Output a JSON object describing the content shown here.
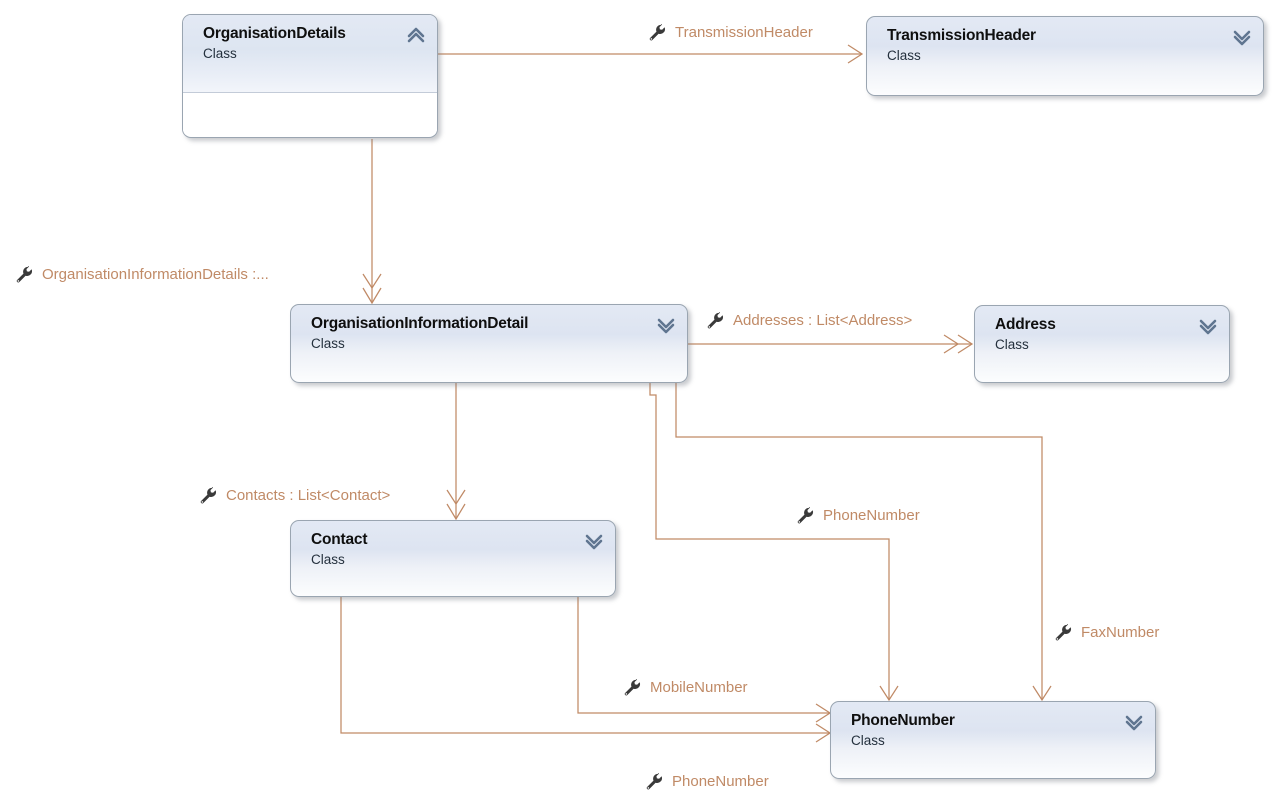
{
  "diagram": {
    "title": "Class Diagram",
    "link_color": "#c08a66",
    "label_color": "#c08a66",
    "class_fill_top": "#e3e9f4",
    "class_fill_bottom": "#fcfdfe",
    "class_border": "#9aa5b1"
  },
  "classes": [
    {
      "id": "organisation-details",
      "name": "OrganisationDetails",
      "stereotype": "Class",
      "expanded": true,
      "chevron": "chevron-up-icon"
    },
    {
      "id": "transmission-header",
      "name": "TransmissionHeader",
      "stereotype": "Class",
      "expanded": false,
      "chevron": "chevron-down-icon"
    },
    {
      "id": "organisation-information-detail",
      "name": "OrganisationInformationDetail",
      "stereotype": "Class",
      "expanded": false,
      "chevron": "chevron-down-icon"
    },
    {
      "id": "address",
      "name": "Address",
      "stereotype": "Class",
      "expanded": false,
      "chevron": "chevron-down-icon"
    },
    {
      "id": "contact",
      "name": "Contact",
      "stereotype": "Class",
      "expanded": false,
      "chevron": "chevron-down-icon"
    },
    {
      "id": "phone-number",
      "name": "PhoneNumber",
      "stereotype": "Class",
      "expanded": false,
      "chevron": "chevron-down-icon"
    }
  ],
  "associations": [
    {
      "id": "assoc-transmission-header",
      "label": "TransmissionHeader",
      "icon": "property-wrench-icon",
      "from": "organisation-details",
      "to": "transmission-header",
      "arrow": "single"
    },
    {
      "id": "assoc-organisation-information-details",
      "label": "OrganisationInformationDetails  :...",
      "icon": "property-wrench-icon",
      "from": "organisation-details",
      "to": "organisation-information-detail",
      "arrow": "double"
    },
    {
      "id": "assoc-addresses",
      "label": "Addresses : List<Address>",
      "icon": "property-wrench-icon",
      "from": "organisation-information-detail",
      "to": "address",
      "arrow": "double"
    },
    {
      "id": "assoc-contacts",
      "label": "Contacts : List<Contact>",
      "icon": "property-wrench-icon",
      "from": "organisation-information-detail",
      "to": "contact",
      "arrow": "double"
    },
    {
      "id": "assoc-phone-number-oid",
      "label": "PhoneNumber",
      "icon": "property-wrench-icon",
      "from": "organisation-information-detail",
      "to": "phone-number",
      "arrow": "single"
    },
    {
      "id": "assoc-fax-number",
      "label": "FaxNumber",
      "icon": "property-wrench-icon",
      "from": "organisation-information-detail",
      "to": "phone-number",
      "arrow": "single"
    },
    {
      "id": "assoc-mobile-number",
      "label": "MobileNumber",
      "icon": "property-wrench-icon",
      "from": "contact",
      "to": "phone-number",
      "arrow": "single"
    },
    {
      "id": "assoc-phone-number-contact",
      "label": "PhoneNumber",
      "icon": "property-wrench-icon",
      "from": "contact",
      "to": "phone-number",
      "arrow": "single"
    }
  ]
}
